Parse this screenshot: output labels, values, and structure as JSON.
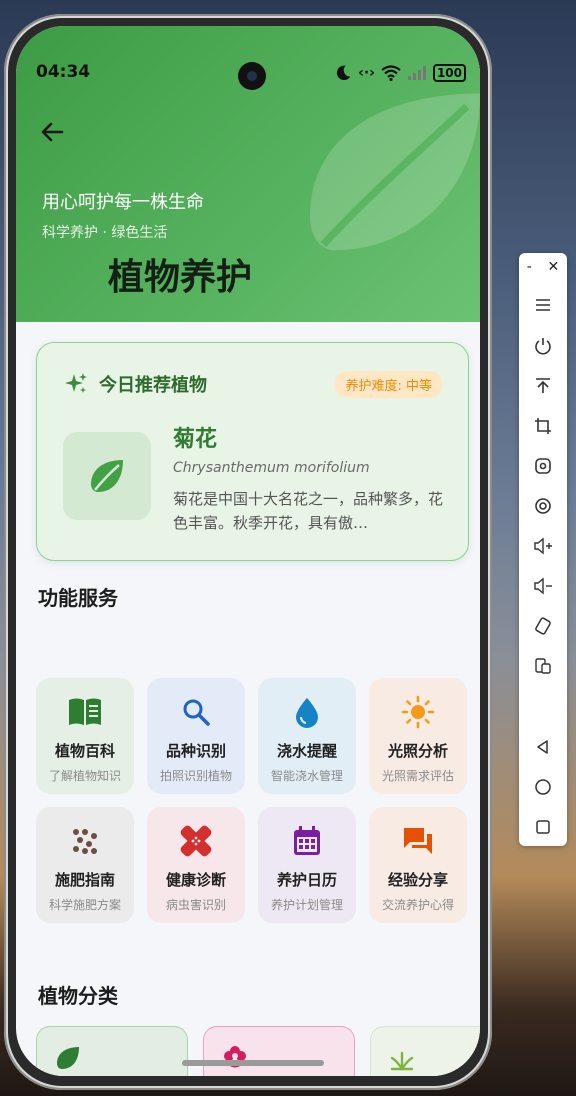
{
  "status_bar": {
    "time": "04:34",
    "battery": "100"
  },
  "header": {
    "slogan": "用心呵护每一株生命",
    "sub_slogan": "科学养护 · 绿色生活",
    "title": "植物养护"
  },
  "recommend": {
    "title": "今日推荐植物",
    "difficulty": "养护难度: 中等",
    "plant_name": "菊花",
    "latin_name": "Chrysanthemum morifolium",
    "description": "菊花是中国十大名花之一，品种繁多，花色丰富。秋季开花，具有傲…"
  },
  "services": {
    "title": "功能服务",
    "items": [
      {
        "name": "植物百科",
        "desc": "了解植物知识",
        "icon": "book-icon",
        "bg": "#e6efe6",
        "color": "#2e7d32"
      },
      {
        "name": "品种识别",
        "desc": "拍照识别植物",
        "icon": "search-icon",
        "bg": "#e4ebf8",
        "color": "#1e63c8"
      },
      {
        "name": "浇水提醒",
        "desc": "智能浇水管理",
        "icon": "water-drop-icon",
        "bg": "#e2eef5",
        "color": "#1683c7"
      },
      {
        "name": "光照分析",
        "desc": "光照需求评估",
        "icon": "sun-icon",
        "bg": "#f7ebe4",
        "color": "#f59a1b"
      },
      {
        "name": "施肥指南",
        "desc": "科学施肥方案",
        "icon": "fertilizer-icon",
        "bg": "#ecebec",
        "color": "#6d4c41"
      },
      {
        "name": "健康诊断",
        "desc": "病虫害识别",
        "icon": "healing-icon",
        "bg": "#f7e7ea",
        "color": "#d32f2f"
      },
      {
        "name": "养护日历",
        "desc": "养护计划管理",
        "icon": "calendar-icon",
        "bg": "#eee8f4",
        "color": "#7b1fa2"
      },
      {
        "name": "经验分享",
        "desc": "交流养护心得",
        "icon": "forum-icon",
        "bg": "#f7ebe4",
        "color": "#e65100"
      }
    ]
  },
  "categories": {
    "title": "植物分类",
    "items": [
      {
        "icon": "leaf-icon",
        "bg": "#e3ede3",
        "border": "#a9d3ab",
        "color": "#2e7d32"
      },
      {
        "icon": "flower-icon",
        "bg": "#f8e3ec",
        "border": "#f0a0c0",
        "color": "#d81b60"
      },
      {
        "icon": "grass-icon",
        "bg": "#eef3ea",
        "border": "#d3e6cf",
        "color": "#7cb342"
      }
    ]
  }
}
